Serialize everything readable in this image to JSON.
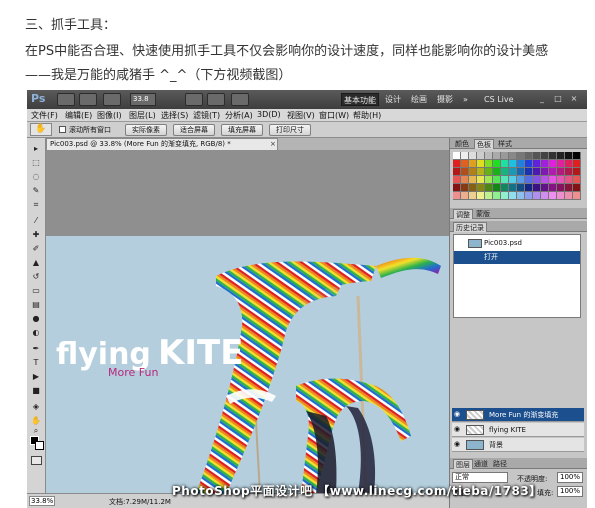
{
  "article": {
    "heading": "三、抓手工具：",
    "line1": "在PS中能否合理、快速使用抓手工具不仅会影响你的设计速度，同样也能影响你的设计美感",
    "line2": "——我是万能的咸猪手 ^_^（下方视频截图）"
  },
  "app": {
    "logo": "Ps",
    "zoom_value": "33.8",
    "workspaces": [
      "基本功能",
      "设计",
      "绘画",
      "摄影"
    ],
    "more": "»",
    "cs_live": "CS Live"
  },
  "menu": [
    "文件(F)",
    "编辑(E)",
    "图像(I)",
    "图层(L)",
    "选择(S)",
    "滤镜(T)",
    "分析(A)",
    "3D(D)",
    "视图(V)",
    "窗口(W)",
    "帮助(H)"
  ],
  "options_bar": {
    "checkbox_label": "滚动所有窗口",
    "buttons": [
      "实际像素",
      "适合屏幕",
      "填充屏幕",
      "打印尺寸"
    ]
  },
  "document": {
    "tab_title": "Pic003.psd @ 33.8% (More Fun 的渐变填充, RGB/8) *",
    "image_text_main": "flying",
    "image_text_kite": "KITE",
    "image_text_sub": "More Fun"
  },
  "panels": {
    "color_tabs": [
      "色板",
      "样式"
    ],
    "adjust_tabs": [
      "调整",
      "蒙版"
    ],
    "history_tab": "历史记录",
    "history_items": [
      "Pic003.psd",
      "打开"
    ],
    "layers_tabs": [
      "图层",
      "通道",
      "路径"
    ],
    "blend_mode": "正常",
    "opacity_label": "不透明度:",
    "opacity_value": "100%",
    "lock_label": "锁定:",
    "fill_label": "填充:",
    "fill_value": "100%",
    "layers": [
      {
        "name": "More Fun 的渐变填充"
      },
      {
        "name": "flying KITE"
      },
      {
        "name": "背景"
      }
    ]
  },
  "status": {
    "zoom": "33.8%",
    "doc_info": "文档:7.29M/11.2M"
  },
  "watermark": "PhotoShop平面设计吧 【www.linecg.com/tieba/1783】",
  "colors": {
    "selection": "#1c4f8e",
    "appbar": "#4a4a4a",
    "sky": "#a9c7d8"
  }
}
